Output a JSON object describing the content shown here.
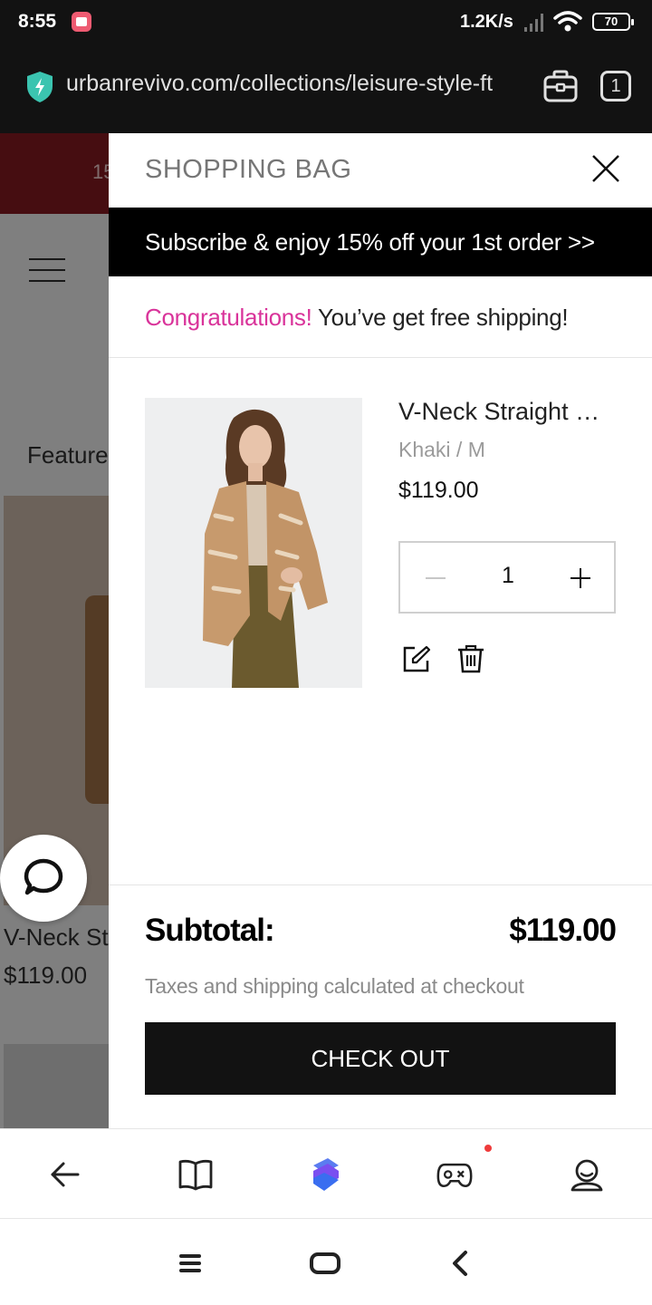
{
  "status_bar": {
    "time": "8:55",
    "network_speed": "1.2K/s",
    "battery": "70"
  },
  "url_bar": {
    "url": "urbanrevivo.com/collections/leisure-style-ft",
    "tab_count": "1"
  },
  "background_page": {
    "banner_text": "15",
    "featured_label": "Feature",
    "product_name": "V-Neck St",
    "product_price": "$119.00"
  },
  "drawer": {
    "title": "SHOPPING BAG",
    "promo_text": "Subscribe & enjoy 15% off your 1st order >>",
    "shipping_highlight": "Congratulations!",
    "shipping_text": " You’ve get free shipping!",
    "item": {
      "name": "V-Neck Straight Bl...",
      "variant": "Khaki / M",
      "price": "$119.00",
      "quantity": "1"
    },
    "subtotal_label": "Subtotal:",
    "subtotal_value": "$119.00",
    "tax_note": "Taxes and shipping calculated at checkout",
    "checkout_label": "CHECK OUT"
  },
  "colors": {
    "accent_pink": "#d9339a",
    "black": "#121212"
  },
  "icons": {
    "close": "close-icon",
    "edit": "edit-icon",
    "delete": "trash-icon",
    "chat": "chat-icon",
    "back": "arrow-left-icon",
    "bookmarks": "book-icon",
    "home": "browser-logo-icon",
    "games": "gamepad-icon",
    "profile": "user-icon"
  }
}
